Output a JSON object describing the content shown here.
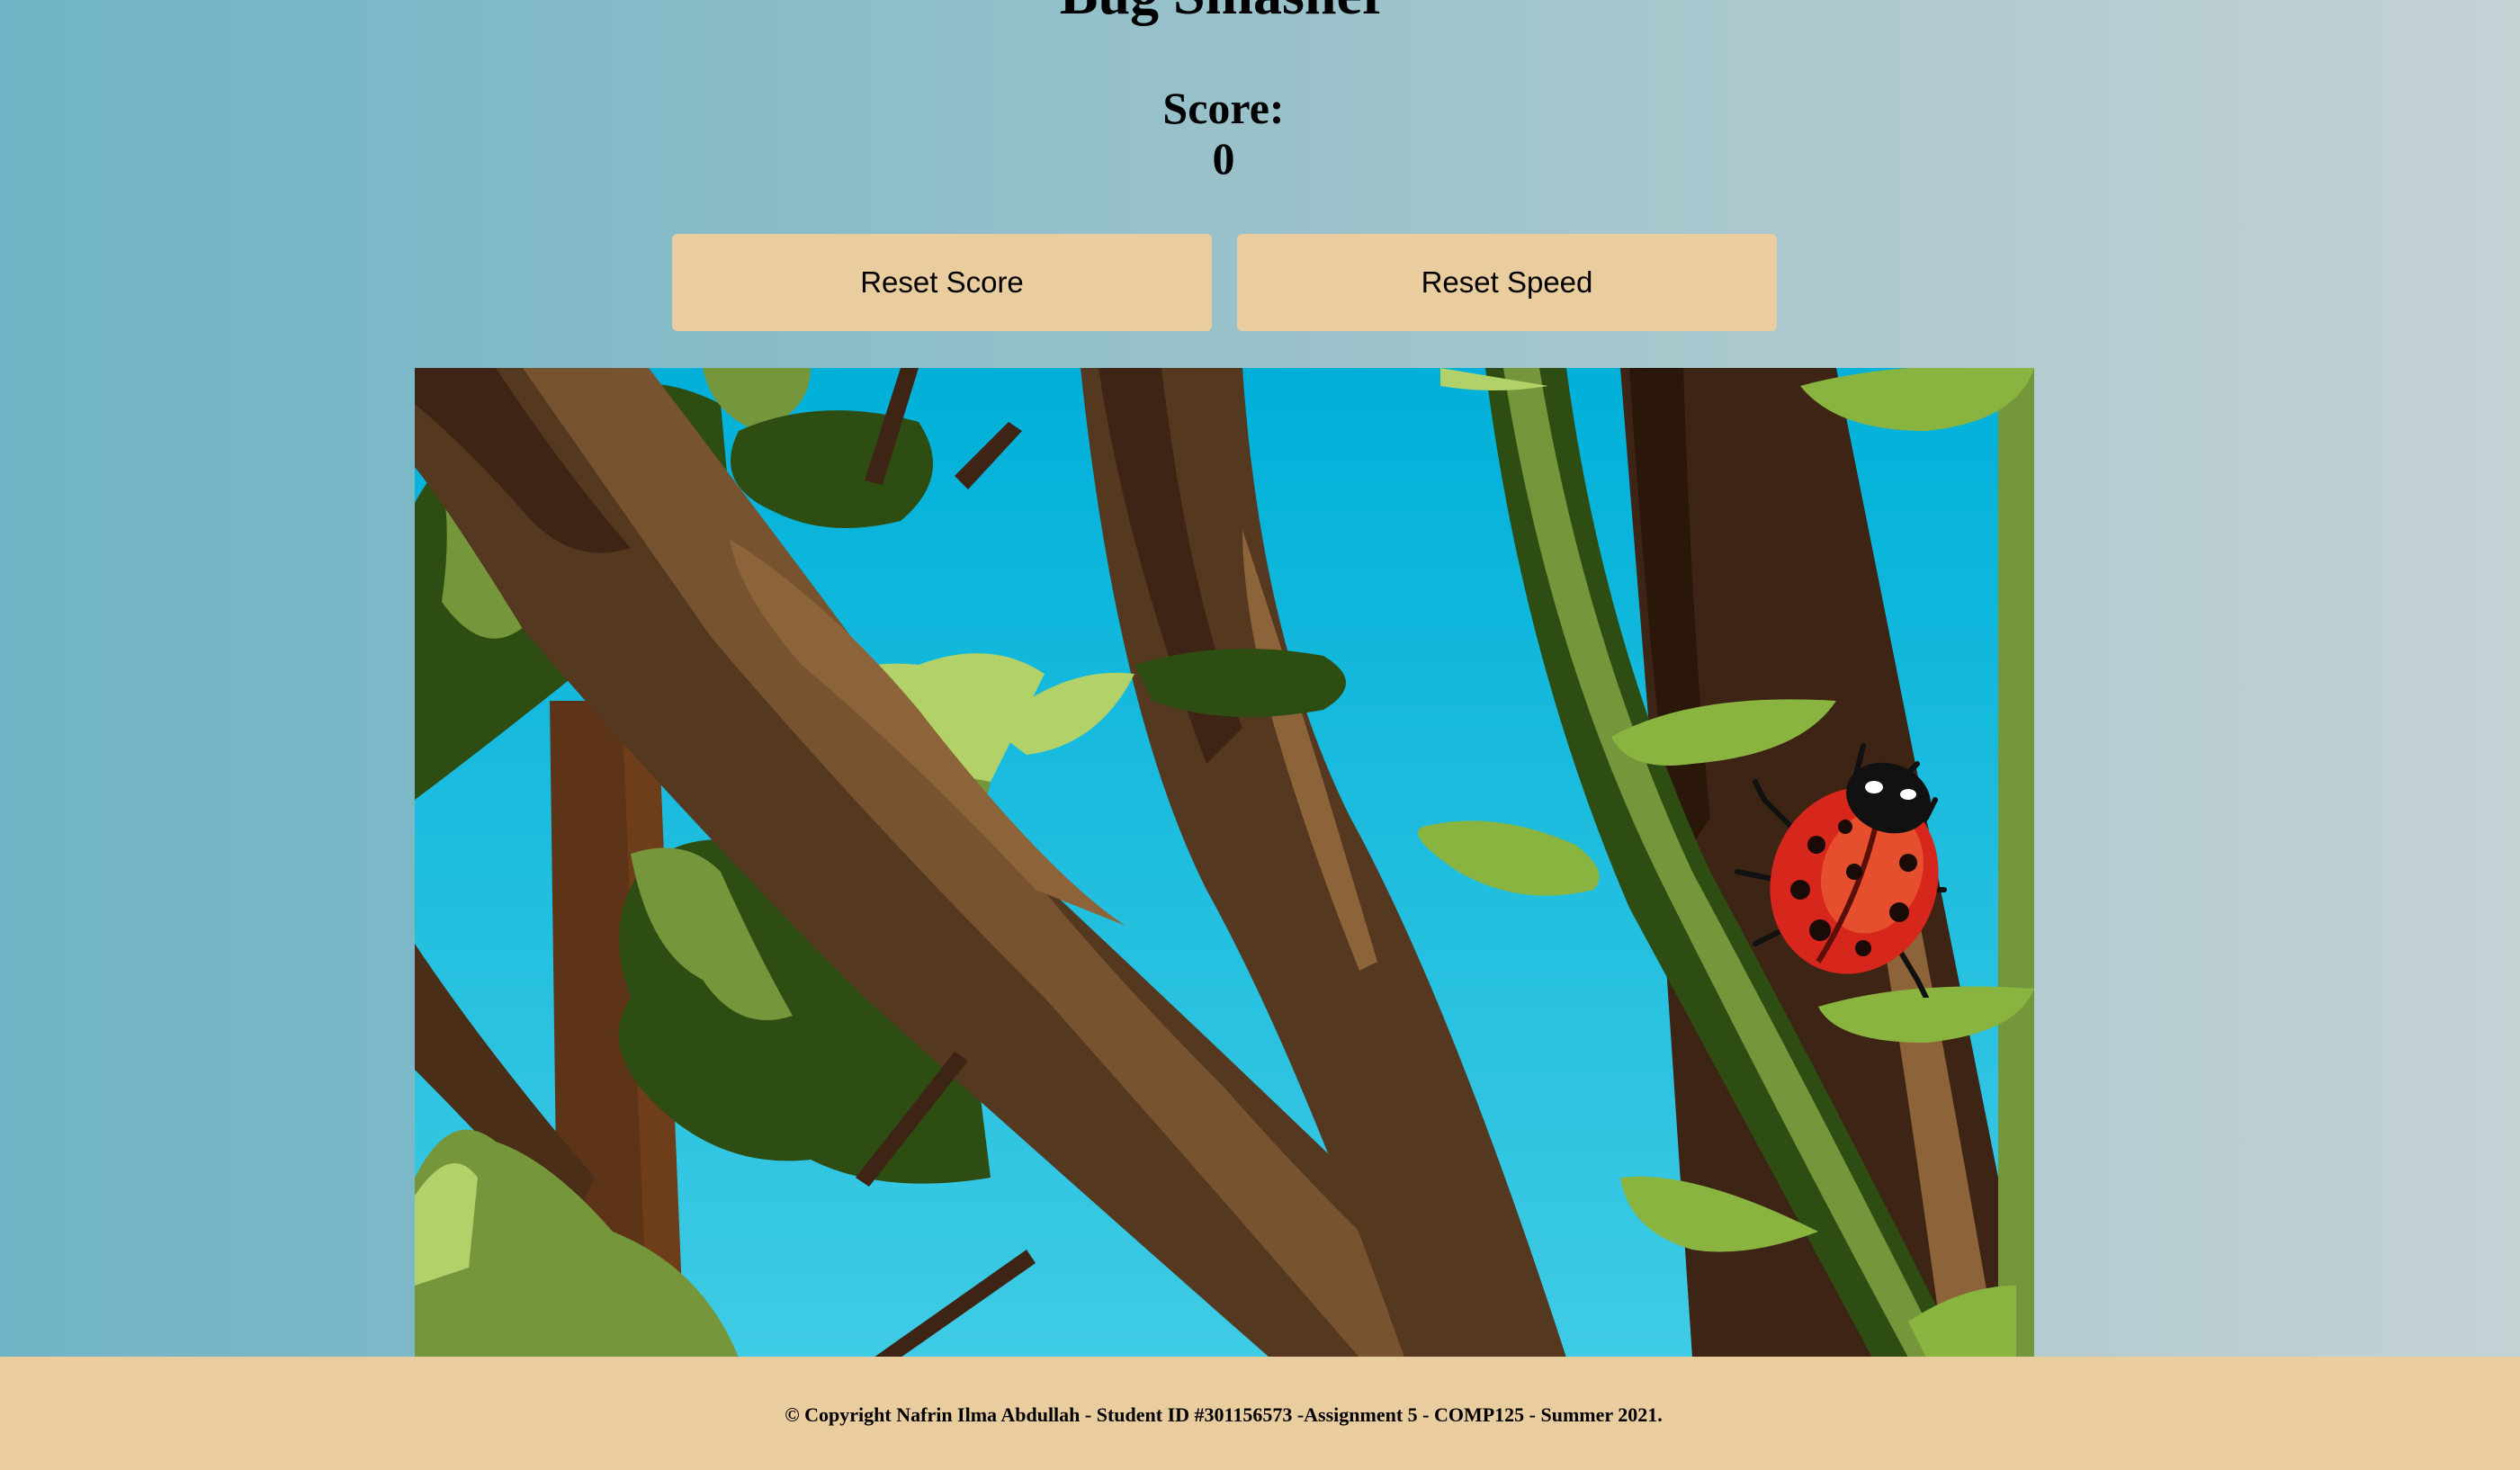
{
  "header": {
    "title": "Bug Smasher"
  },
  "score": {
    "label": "Score:",
    "value": "0"
  },
  "controls": {
    "reset_score_label": "Reset Score",
    "reset_speed_label": "Reset Speed"
  },
  "game": {
    "bug_icon": "ladybug-icon",
    "background": "tree-branches-scene",
    "colors": {
      "sky": "#00b0d9",
      "bark": "#553820",
      "leaf": "#8ab440",
      "button": "#e9cd9f"
    }
  },
  "footer": {
    "text": "© Copyright Nafrin Ilma Abdullah - Student ID #301156573 -Assignment 5 - COMP125 - Summer 2021."
  }
}
